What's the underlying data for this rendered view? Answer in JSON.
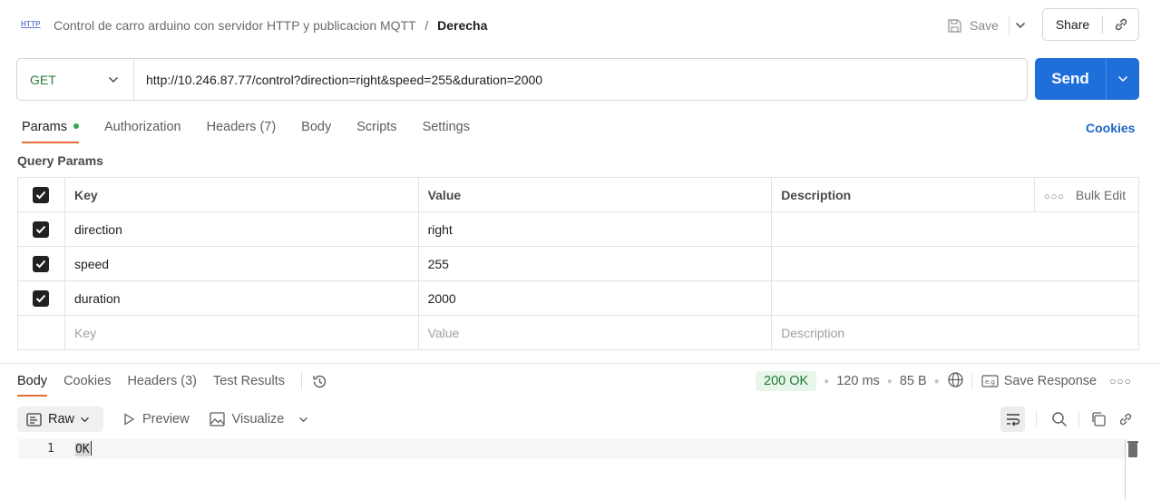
{
  "header": {
    "icon_label": "HTTP",
    "collection_name": "Control de carro arduino con servidor HTTP y publicacion MQTT",
    "separator": "/",
    "request_name": "Derecha",
    "save_label": "Save",
    "share_label": "Share"
  },
  "request": {
    "method": "GET",
    "url": "http://10.246.87.77/control?direction=right&speed=255&duration=2000",
    "send_label": "Send"
  },
  "request_tabs": {
    "items": [
      {
        "label": "Params",
        "active": true
      },
      {
        "label": "Authorization"
      },
      {
        "label": "Headers (7)"
      },
      {
        "label": "Body"
      },
      {
        "label": "Scripts"
      },
      {
        "label": "Settings"
      }
    ],
    "cookies_label": "Cookies"
  },
  "query_params": {
    "section_label": "Query Params",
    "headers": {
      "key": "Key",
      "value": "Value",
      "description": "Description",
      "bulk_edit": "Bulk Edit"
    },
    "rows": [
      {
        "key": "direction",
        "value": "right",
        "description": "",
        "checked": true
      },
      {
        "key": "speed",
        "value": "255",
        "description": "",
        "checked": true
      },
      {
        "key": "duration",
        "value": "2000",
        "description": "",
        "checked": true
      }
    ],
    "placeholders": {
      "key": "Key",
      "value": "Value",
      "description": "Description"
    }
  },
  "response_tabs": {
    "items": [
      {
        "label": "Body",
        "active": true
      },
      {
        "label": "Cookies"
      },
      {
        "label": "Headers (3)"
      },
      {
        "label": "Test Results"
      }
    ]
  },
  "response_meta": {
    "status": "200 OK",
    "time": "120 ms",
    "size": "85 B",
    "save_response_label": "Save Response",
    "status_color": "#1c7a33"
  },
  "body_toolbar": {
    "format": "Raw",
    "preview_label": "Preview",
    "visualize_label": "Visualize"
  },
  "editor": {
    "line_number": "1",
    "content": "OK"
  },
  "colors": {
    "accent": "#1f6fdb",
    "tab_underline": "#e86b3a",
    "method_get": "#2b7d3d"
  }
}
